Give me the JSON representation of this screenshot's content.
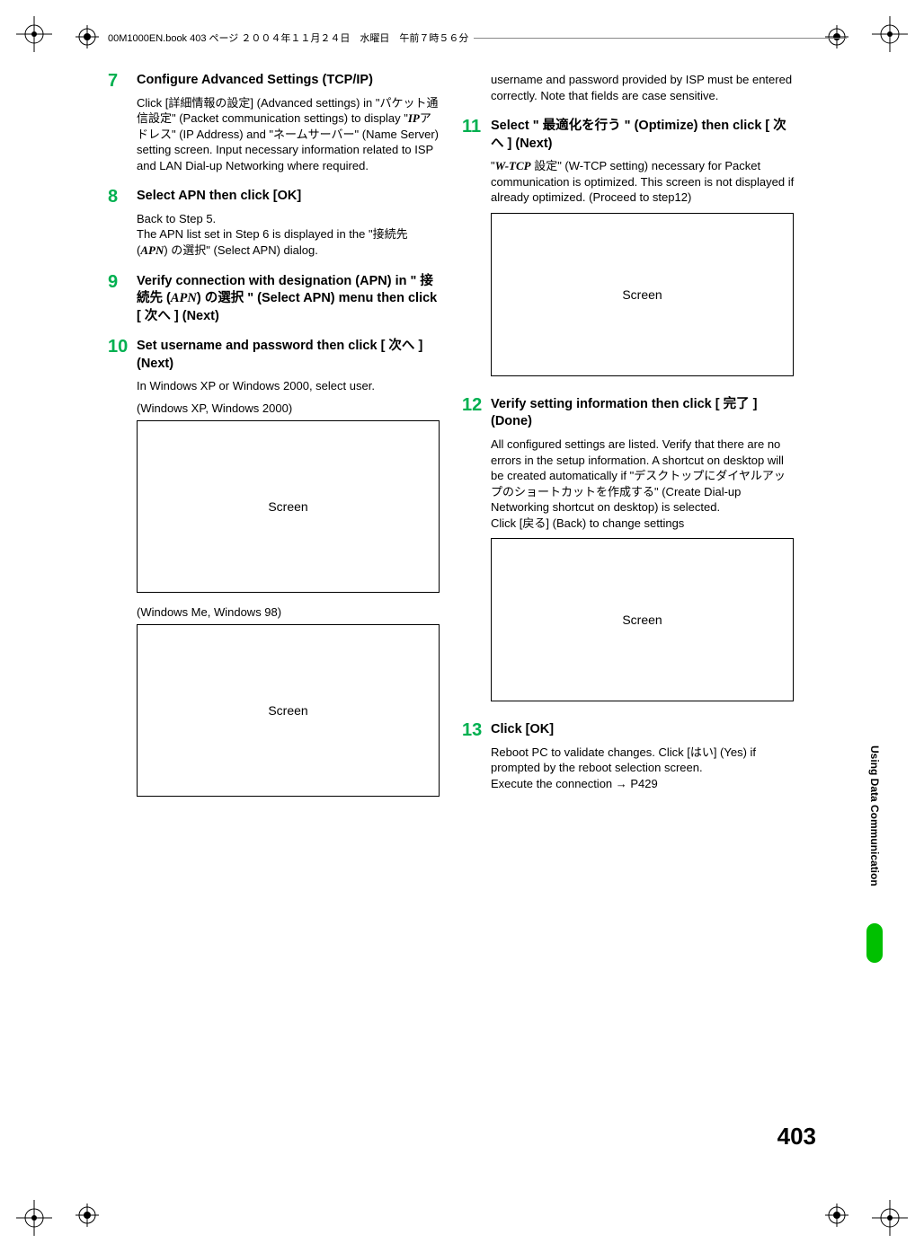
{
  "header": "00M1000EN.book  403 ページ  ２００４年１１月２４日　水曜日　午前７時５６分",
  "side_tab": "Using Data Communication",
  "page_number": "403",
  "screen_label": "Screen",
  "steps_left": [
    {
      "num": "7",
      "title_parts": [
        "Configure Advanced Settings (TCP/IP)"
      ],
      "desc_html": "Click [詳細情報の設定] (Advanced settings) in \"パケット通信設定\" (Packet communication settings) to display \"<span class='italic-serif'>IP</span>アドレス\" (IP Address) and \"ネームサーバー\" (Name Server) setting screen. Input necessary information related to ISP and LAN Dial-up Networking where required."
    },
    {
      "num": "8",
      "title_parts": [
        "Select APN then click [OK]"
      ],
      "desc_html": "Back to Step 5.<br>The APN list set in Step 6 is displayed in the \"接続先 (<span class='italic-serif'>APN</span>) の選択\" (Select APN) dialog."
    },
    {
      "num": "9",
      "title_parts": [
        "Verify connection with designation (APN) in \" 接続先 (<span class='italic-serif'>APN</span>) の選択 \" (Select APN) menu then click [ 次へ ] (Next)"
      ],
      "desc_html": ""
    },
    {
      "num": "10",
      "title_parts": [
        "Set username and password then click [ 次へ ] (Next)"
      ],
      "desc_html": "In Windows XP or Windows 2000, select user.",
      "caption1": "(Windows XP, Windows 2000)",
      "caption2": "(Windows Me, Windows 98)"
    }
  ],
  "steps_right": [
    {
      "pre_desc": "username and password provided by ISP must be entered correctly. Note that fields are case sensitive."
    },
    {
      "num": "11",
      "title_parts": [
        "Select \" 最適化を行う \" (Optimize) then click [ 次へ ] (Next)"
      ],
      "desc_html": "\"<span class='italic-serif'>W-TCP</span> 設定\" (W-TCP setting) necessary for Packet communication is optimized. This screen is not displayed if already optimized. (Proceed to step12)"
    },
    {
      "num": "12",
      "title_parts": [
        "Verify setting information then click [ 完了 ] (Done)"
      ],
      "desc_html": "All configured settings are listed. Verify that there are no errors in the setup information. A shortcut on desktop will be created automatically if \"デスクトップにダイヤルアップのショートカットを作成する\" (Create Dial-up Networking shortcut on desktop) is selected.<br>Click [戻る] (Back) to change settings"
    },
    {
      "num": "13",
      "title_parts": [
        "Click [OK]"
      ],
      "desc_html": "Reboot PC to validate changes. Click [はい] (Yes) if prompted by the reboot selection screen.<br>Execute the connection → P429"
    }
  ]
}
